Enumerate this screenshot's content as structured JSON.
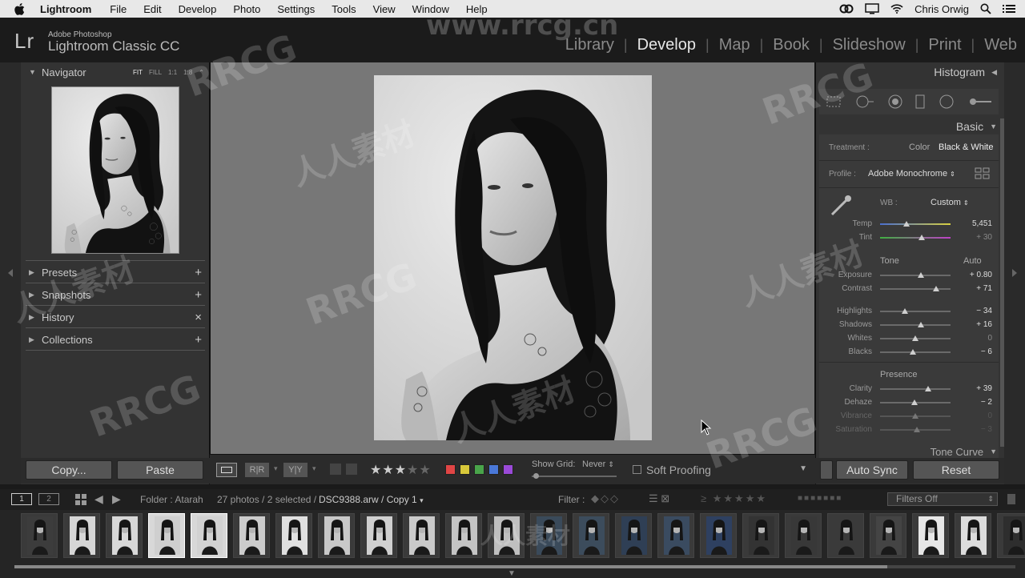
{
  "menubar": {
    "app": "Lightroom",
    "items": [
      "File",
      "Edit",
      "Develop",
      "Photo",
      "Settings",
      "Tools",
      "View",
      "Window",
      "Help"
    ],
    "user": "Chris Orwig"
  },
  "identity": {
    "logo": "Lr",
    "line1": "Adobe Photoshop",
    "line2": "Lightroom Classic CC"
  },
  "modules": [
    "Library",
    "Develop",
    "Map",
    "Book",
    "Slideshow",
    "Print",
    "Web"
  ],
  "active_module": "Develop",
  "left": {
    "navigator": "Navigator",
    "zoom": [
      "FIT",
      "FILL",
      "1:1",
      "1:8"
    ],
    "panels": [
      "Presets",
      "Snapshots",
      "History",
      "Collections"
    ],
    "copy_label": "Copy...",
    "paste_label": "Paste"
  },
  "toolbar": {
    "show_grid_label": "Show Grid:",
    "show_grid_value": "Never",
    "soft_proofing": "Soft Proofing",
    "rating_stars": 3,
    "color_labels": [
      "#e04545",
      "#d8c83a",
      "#49a44a",
      "#4a78d8",
      "#9a4ad8"
    ]
  },
  "right": {
    "histogram": "Histogram",
    "basic": "Basic",
    "treatment_label": "Treatment :",
    "treatment_color": "Color",
    "treatment_bw": "Black & White",
    "profile_label": "Profile :",
    "profile_value": "Adobe Monochrome",
    "wb_label": "WB :",
    "wb_value": "Custom",
    "temp_label": "Temp",
    "temp_value": "5,451",
    "tint_label": "Tint",
    "tint_value": "+ 30",
    "tone_label": "Tone",
    "auto_label": "Auto",
    "exposure_label": "Exposure",
    "exposure_value": "+ 0.80",
    "contrast_label": "Contrast",
    "contrast_value": "+ 71",
    "highlights_label": "Highlights",
    "highlights_value": "− 34",
    "shadows_label": "Shadows",
    "shadows_value": "+ 16",
    "whites_label": "Whites",
    "whites_value": "0",
    "blacks_label": "Blacks",
    "blacks_value": "− 6",
    "presence_label": "Presence",
    "clarity_label": "Clarity",
    "clarity_value": "+ 39",
    "dehaze_label": "Dehaze",
    "dehaze_value": "− 2",
    "vibrance_label": "Vibrance",
    "vibrance_value": "0",
    "saturation_label": "Saturation",
    "saturation_value": "− 3",
    "tone_curve": "Tone Curve",
    "auto_sync": "Auto Sync",
    "reset": "Reset",
    "slider_levels": {
      "temp": 0.37,
      "tint": 0.59,
      "exposure": 0.58,
      "contrast": 0.8,
      "highlights": 0.35,
      "shadows": 0.58,
      "whites": 0.5,
      "blacks": 0.47,
      "clarity": 0.68,
      "dehaze": 0.49,
      "vibrance": 0.5,
      "saturation": 0.52
    }
  },
  "filmstrip": {
    "view1": "1",
    "view2": "2",
    "folder": "Folder : Atarah",
    "count": "27 photos / 2 selected /",
    "filename": "DSC9388.arw / Copy 1",
    "filter_label": "Filter :",
    "filter_value": "Filters Off",
    "selected_thumbs": [
      3,
      4
    ]
  },
  "watermark": {
    "url": "www.rrcg.cn",
    "brand": "RRCG",
    "cn": "人人素材"
  }
}
